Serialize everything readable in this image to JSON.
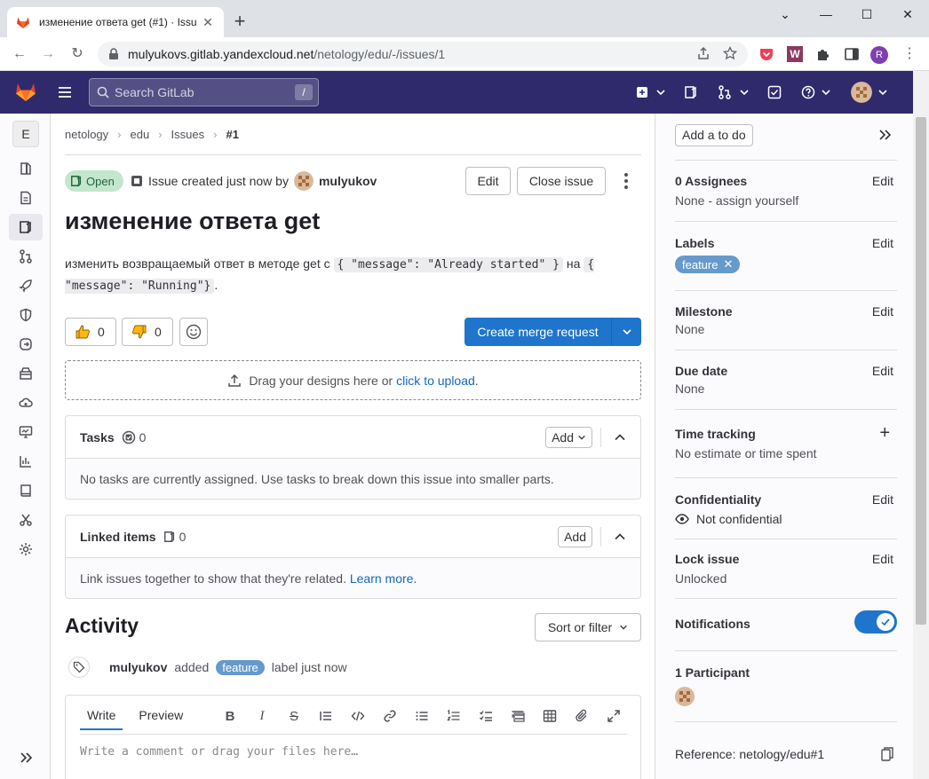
{
  "browser": {
    "tab_title": "изменение ответа get (#1) · Issu",
    "url_domain": "mulyukovs.gitlab.yandexcloud.net",
    "url_path": "/netology/edu/-/issues/1",
    "profile_initial": "R"
  },
  "header": {
    "search_placeholder": "Search GitLab",
    "search_shortcut": "/"
  },
  "sidebar": {
    "project_initial": "E",
    "items": [
      "project-information",
      "repository",
      "issues",
      "merge-requests",
      "ci-cd",
      "security",
      "deployments",
      "packages",
      "infrastructure",
      "monitor",
      "analytics",
      "wiki",
      "snippets",
      "settings"
    ]
  },
  "breadcrumb": [
    "netology",
    "edu",
    "Issues",
    "#1"
  ],
  "issue": {
    "status": "Open",
    "created_text": "Issue created just now by",
    "author": "mulyukov",
    "edit_label": "Edit",
    "close_label": "Close issue",
    "title": "изменение ответа get",
    "desc_prefix": "изменить возвращаемый ответ в методе get с",
    "code1": "{ \"message\": \"Already started\" }",
    "desc_mid": "на",
    "code2": "{ \"message\": \"Running\"}",
    "desc_suffix": ".",
    "thumbs_up": "0",
    "thumbs_down": "0",
    "create_mr_label": "Create merge request",
    "drop_text": "Drag your designs here or",
    "drop_link": "click to upload",
    "drop_end": "."
  },
  "tasks": {
    "title": "Tasks",
    "count": "0",
    "add_label": "Add",
    "empty": "No tasks are currently assigned. Use tasks to break down this issue into smaller parts."
  },
  "linked": {
    "title": "Linked items",
    "count": "0",
    "add_label": "Add",
    "empty": "Link issues together to show that they're related.",
    "learn_more": "Learn more."
  },
  "activity": {
    "title": "Activity",
    "sort_label": "Sort or filter",
    "note_user": "mulyukov",
    "note_added": "added",
    "note_label": "feature",
    "note_tail": "label just now"
  },
  "editor": {
    "tab_write": "Write",
    "tab_preview": "Preview",
    "placeholder": "Write a comment or drag your files here…"
  },
  "right": {
    "todo_label": "Add a to do",
    "assignees_title": "0 Assignees",
    "assignees_value": "None - assign yourself",
    "labels_title": "Labels",
    "label_pill": "feature",
    "milestone_title": "Milestone",
    "milestone_value": "None",
    "due_title": "Due date",
    "due_value": "None",
    "time_title": "Time tracking",
    "time_value": "No estimate or time spent",
    "conf_title": "Confidentiality",
    "conf_value": "Not confidential",
    "lock_title": "Lock issue",
    "lock_value": "Unlocked",
    "notif_title": "Notifications",
    "notifications_on": true,
    "participants_title": "1 Participant",
    "reference": "Reference: netology/edu#1",
    "edit_label": "Edit"
  }
}
